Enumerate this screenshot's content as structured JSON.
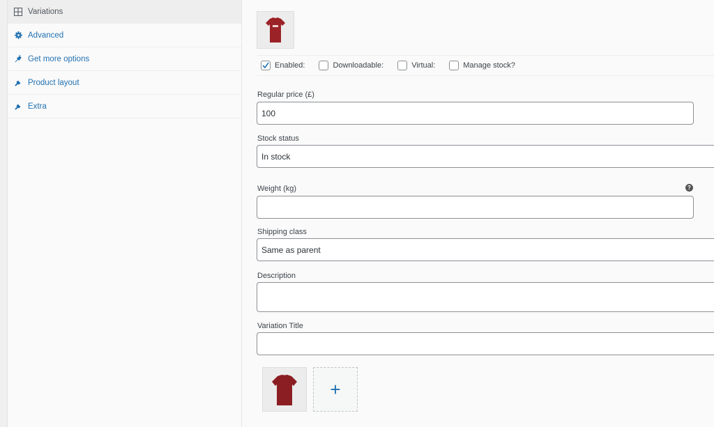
{
  "sidebar": {
    "items": [
      {
        "label": "Variations",
        "icon": "grid-icon",
        "active": true
      },
      {
        "label": "Advanced",
        "icon": "gear-icon"
      },
      {
        "label": "Get more options",
        "icon": "plug-icon"
      },
      {
        "label": "Product layout",
        "icon": "wrench-icon"
      },
      {
        "label": "Extra",
        "icon": "wrench-icon"
      }
    ]
  },
  "variation": {
    "options": [
      {
        "label": "Enabled:",
        "checked": true
      },
      {
        "label": "Downloadable:",
        "checked": false
      },
      {
        "label": "Virtual:",
        "checked": false
      },
      {
        "label": "Manage stock?",
        "checked": false
      }
    ],
    "regular_price": {
      "label": "Regular price (£)",
      "value": "100"
    },
    "stock_status": {
      "label": "Stock status",
      "value": "In stock"
    },
    "weight": {
      "label": "Weight (kg)",
      "value": "",
      "help": "?"
    },
    "shipping_class": {
      "label": "Shipping class",
      "value": "Same as parent"
    },
    "description": {
      "label": "Description",
      "value": ""
    },
    "variation_title": {
      "label": "Variation Title",
      "value": ""
    },
    "gallery_add": "+"
  },
  "colors": {
    "accent": "#2271b1",
    "shirt": "#9b2226"
  }
}
